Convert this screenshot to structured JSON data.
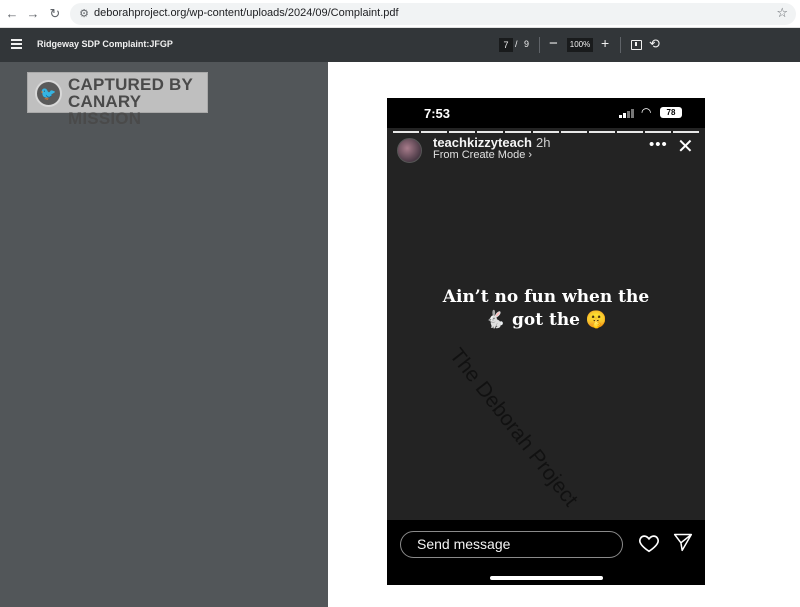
{
  "browser": {
    "url": "deborahproject.org/wp-content/uploads/2024/09/Complaint.pdf",
    "icons": [
      "back-arrow-icon",
      "forward-arrow-icon",
      "reload-icon",
      "site-info-icon",
      "bookmark-star-icon"
    ]
  },
  "pdf_toolbar": {
    "title": "Ridgeway SDP Complaint:JFGP",
    "current_page": "7",
    "separator": "/",
    "total_pages": "9",
    "zoom": "100%",
    "zoom_out": "−",
    "zoom_in": "+"
  },
  "stamp": {
    "line1": "CAPTURED BY",
    "line2": "CANARY MISSION"
  },
  "story": {
    "time": "7:53",
    "battery": "78",
    "segments_total": 11,
    "segments_viewed": 11,
    "username": "teachkizzyteach",
    "posted_ago": "2h",
    "subtitle": "From Create Mode ›",
    "caption_line1": "Ain’t no fun when the",
    "caption_line2": "🐇 got the 🤫",
    "watermark": "The Deborah Project",
    "send_placeholder": "Send message"
  },
  "colors": {
    "toolbar": "#323639",
    "viewer_bg": "#525659",
    "story_bg": "#232323",
    "stamp_bg": "#bfbfbf"
  }
}
